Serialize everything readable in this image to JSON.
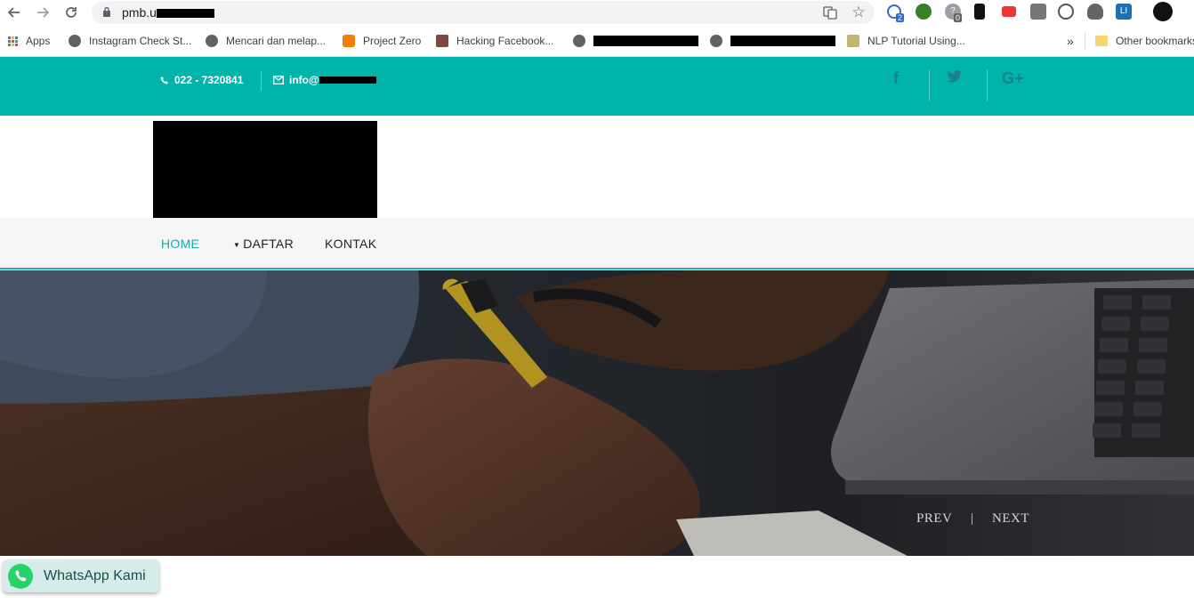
{
  "browser": {
    "url_visible": "pmb.u",
    "bookmarks": [
      {
        "label": "Apps",
        "color": "#e8453c"
      },
      {
        "label": "Instagram Check St...",
        "color": "#5f6368"
      },
      {
        "label": "Mencari dan melap...",
        "color": "#5f6368"
      },
      {
        "label": "Project Zero",
        "color": "#f57c00"
      },
      {
        "label": "Hacking Facebook...",
        "color": "#7a4a3a"
      },
      {
        "label": "",
        "color": "#5f6368"
      },
      {
        "label": "",
        "color": "#5f6368"
      },
      {
        "label": "NLP Tutorial Using...",
        "color": "#c8b270"
      }
    ],
    "more_label": "»",
    "other_bookmarks": "Other bookmarks",
    "ext_badges": [
      "2",
      "0"
    ]
  },
  "topbar": {
    "phone": "022 - 7320841",
    "email": "info@",
    "bg_color": "#00b4aa",
    "social_icons": [
      "facebook-icon",
      "twitter-icon",
      "google-plus-icon"
    ],
    "social": {
      "facebook": "f",
      "twitter": "t",
      "google_plus": "G+"
    }
  },
  "menu": {
    "items": [
      {
        "label": "HOME",
        "active": true
      },
      {
        "label": "DAFTAR",
        "dropdown": true
      },
      {
        "label": "KONTAK"
      }
    ]
  },
  "hero": {
    "prev": "PREV",
    "separator": "|",
    "next": "NEXT"
  },
  "whatsapp": {
    "label": "WhatsApp Kami",
    "icon": "whatsapp-icon",
    "color": "#25d366"
  }
}
